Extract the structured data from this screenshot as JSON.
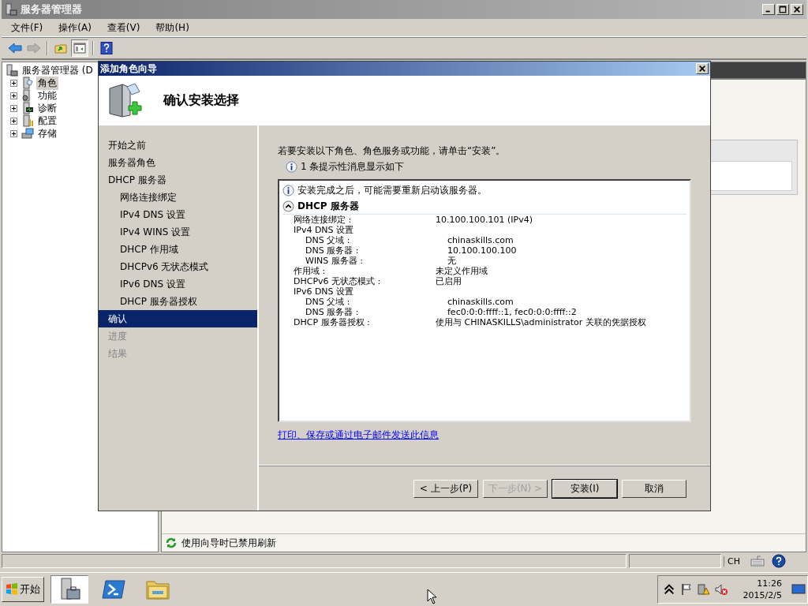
{
  "window": {
    "title": "服务器管理器"
  },
  "menu": [
    "文件(F)",
    "操作(A)",
    "查看(V)",
    "帮助(H)"
  ],
  "toolbar": [
    {
      "kind": "back",
      "disabled": false,
      "pressed": false
    },
    {
      "kind": "forward",
      "disabled": true,
      "pressed": false
    },
    {
      "kind": "up",
      "disabled": false,
      "pressed": false
    },
    {
      "kind": "pane",
      "disabled": false,
      "pressed": true
    },
    {
      "kind": "help",
      "disabled": false,
      "pressed": false
    }
  ],
  "tree": {
    "root": "服务器管理器 (D",
    "children": [
      {
        "label": "角色",
        "kind": "roles",
        "selected": true,
        "expanded": false
      },
      {
        "label": "功能",
        "kind": "features",
        "selected": false,
        "expanded": false
      },
      {
        "label": "诊断",
        "kind": "diagnostics",
        "selected": false,
        "expanded": false
      },
      {
        "label": "配置",
        "kind": "configuration",
        "selected": false,
        "expanded": false
      },
      {
        "label": "存储",
        "kind": "storage",
        "selected": false,
        "expanded": false
      }
    ]
  },
  "wizard": {
    "title": "添加角色向导",
    "heading": "确认安装选择",
    "steps": [
      {
        "label": "开始之前",
        "selected": false,
        "disabled": false
      },
      {
        "label": "服务器角色",
        "selected": false,
        "disabled": false
      },
      {
        "label": "DHCP 服务器",
        "selected": false,
        "disabled": false,
        "children": [
          {
            "label": "网络连接绑定",
            "selected": false,
            "disabled": false
          },
          {
            "label": "IPv4 DNS 设置",
            "selected": false,
            "disabled": false
          },
          {
            "label": "IPv4 WINS 设置",
            "selected": false,
            "disabled": false
          },
          {
            "label": "DHCP 作用域",
            "selected": false,
            "disabled": false
          },
          {
            "label": "DHCPv6 无状态模式",
            "selected": false,
            "disabled": false
          },
          {
            "label": "IPv6 DNS 设置",
            "selected": false,
            "disabled": false
          },
          {
            "label": "DHCP 服务器授权",
            "selected": false,
            "disabled": false
          }
        ]
      },
      {
        "label": "确认",
        "selected": true,
        "disabled": false
      },
      {
        "label": "进度",
        "selected": false,
        "disabled": true
      },
      {
        "label": "结果",
        "selected": false,
        "disabled": true
      }
    ],
    "intro": "若要安装以下角色、角色服务或功能，请单击“安装”。",
    "notice": "1 条提示性消息显示如下",
    "messages": [
      "安装完成之后，可能需要重新启动该服务器。"
    ],
    "section": {
      "title": "DHCP 服务器",
      "expanded": true,
      "rows": [
        {
          "label": "网络连接绑定 :",
          "value": "10.100.100.101 (IPv4)"
        },
        {
          "label": "IPv4 DNS 设置",
          "children": [
            {
              "label": "DNS 父域 :",
              "value": "chinaskills.com"
            },
            {
              "label": "DNS 服务器 :",
              "value": "10.100.100.100"
            },
            {
              "label": "WINS 服务器 :",
              "value": "无"
            }
          ]
        },
        {
          "label": "作用域 :",
          "value": "未定义作用域"
        },
        {
          "label": "DHCPv6 无状态模式 :",
          "value": "已启用"
        },
        {
          "label": "IPv6 DNS 设置",
          "children": [
            {
              "label": "DNS 父域 :",
              "value": "chinaskills.com"
            },
            {
              "label": "DNS 服务器 :",
              "value": "fec0:0:0:ffff::1, fec0:0:0:ffff::2"
            }
          ]
        },
        {
          "label": "DHCP 服务器授权 :",
          "value": "使用与 CHINASKILLS\\administrator 关联的凭据授权"
        }
      ]
    },
    "link": "打印、保存或通过电子邮件发送此信息",
    "buttons": [
      {
        "label": "< 上一步(P)",
        "disabled": false,
        "default": false
      },
      {
        "label": "下一步(N) >",
        "disabled": true,
        "default": false
      },
      {
        "label": "安装(I)",
        "disabled": false,
        "default": true
      },
      {
        "label": "取消",
        "disabled": false,
        "default": false
      }
    ]
  },
  "status_text": "使用向导时已禁用刷新",
  "status_bar": {
    "language": "CH"
  },
  "taskbar": {
    "start": "开始",
    "apps": [
      {
        "kind": "server-manager",
        "selected": true
      },
      {
        "kind": "powershell",
        "selected": false
      },
      {
        "kind": "explorer",
        "selected": false
      }
    ],
    "clock": {
      "time": "11:26",
      "date": "2015/2/5"
    }
  }
}
